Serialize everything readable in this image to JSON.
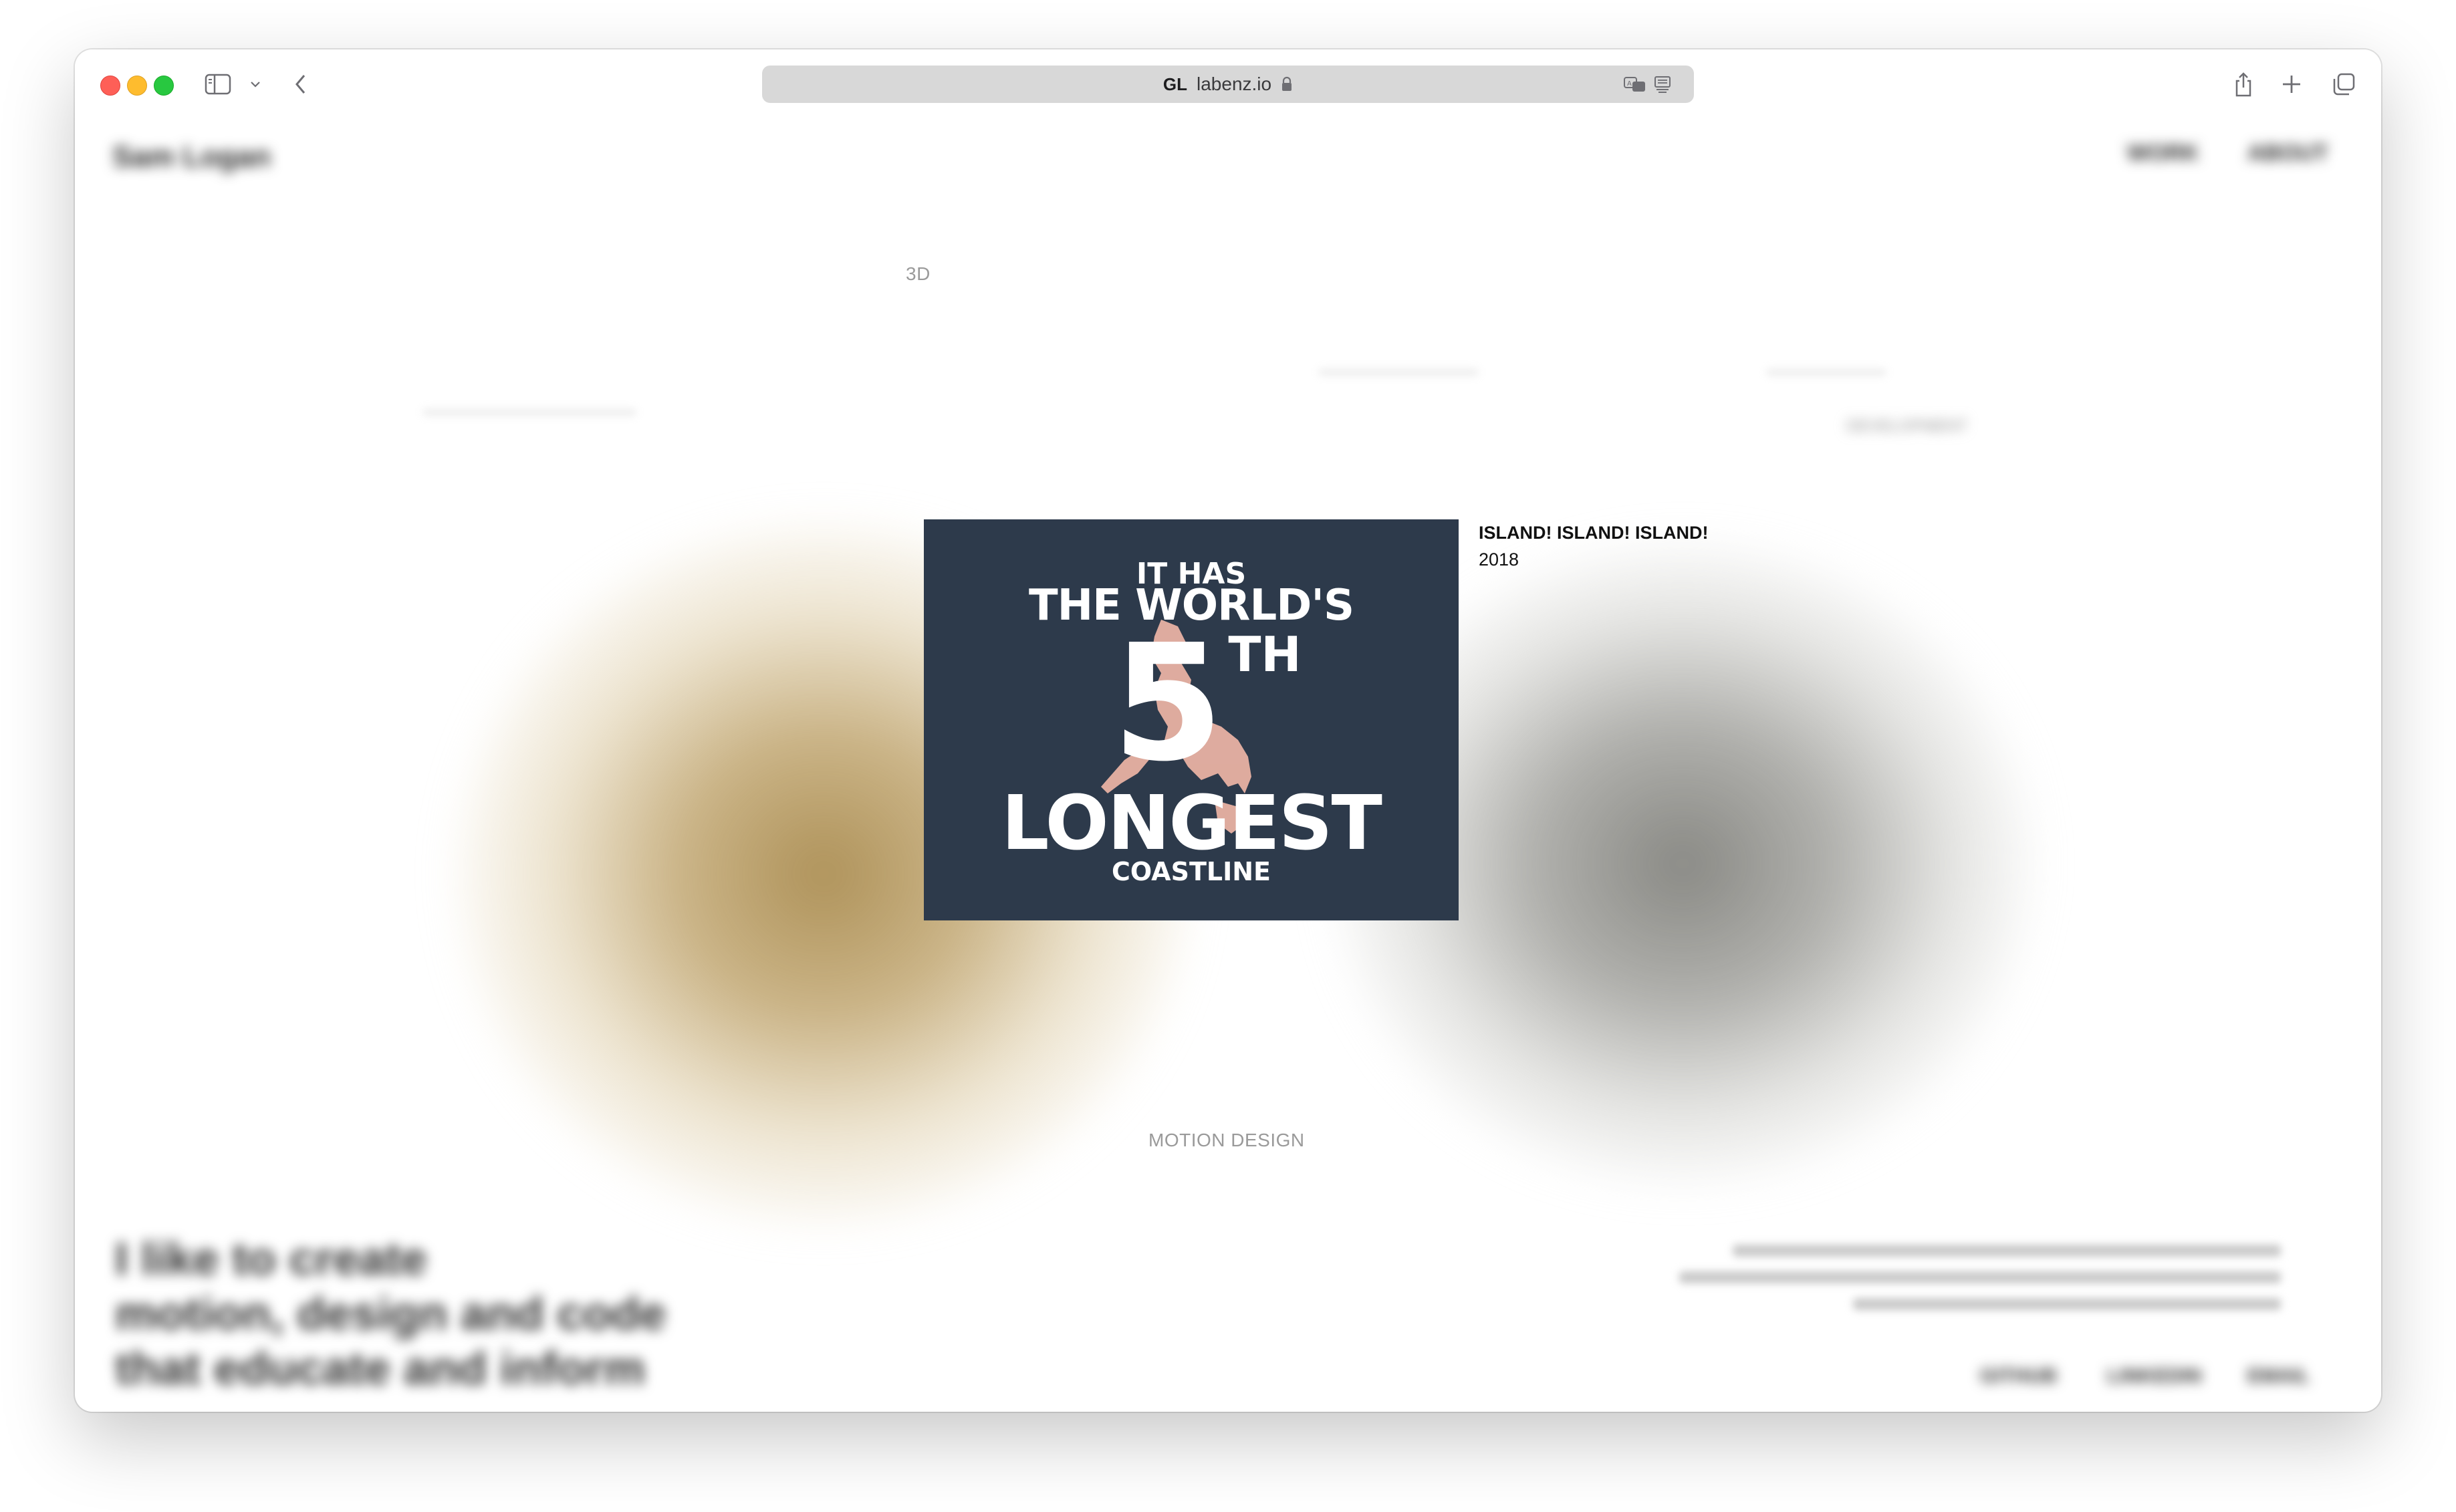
{
  "browser": {
    "address_bar": {
      "favicon_text": "GL",
      "url": "labenz.io"
    }
  },
  "page": {
    "category_tags": {
      "top": "3D",
      "bottom": "MOTION DESIGN"
    },
    "blurred_content": {
      "header_left": "Sam Logan",
      "header_right_links": [
        "WORK",
        "ABOUT"
      ],
      "tagline_lines": [
        "I like to create",
        "motion, design and code",
        "that educate and inform"
      ],
      "footer_links": [
        "GITHUB",
        "LINKEDIN",
        "EMAIL"
      ],
      "side_label": "DEVELOPMENT"
    },
    "featured_project": {
      "title": "ISLAND! ISLAND! ISLAND!",
      "year": "2018",
      "poster_lines": [
        "IT HAS",
        "THE WORLD'S",
        "5",
        "TH",
        "LONGEST",
        "COASTLINE"
      ],
      "colors": {
        "background": "#2d3a4b",
        "text": "#ffffff",
        "map": "#f2b8a8"
      }
    }
  }
}
